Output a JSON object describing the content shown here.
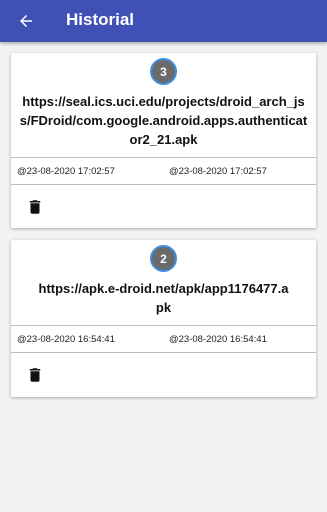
{
  "header": {
    "title": "Historial",
    "back_icon": "arrow-left-icon",
    "color": "#3f51b5"
  },
  "history": [
    {
      "badge": "3",
      "url": "https://seal.ics.uci.edu/projects/droid_arch_jss/FDroid/com.google.android.apps.authenticator2_21.apk",
      "date_start": "@23-08-2020 17:02:57",
      "date_end": "@23-08-2020 17:02:57",
      "delete_icon": "trash-icon"
    },
    {
      "badge": "2",
      "url": "https://apk.e-droid.net/apk/app1176477.apk",
      "date_start": "@23-08-2020 16:54:41",
      "date_end": "@23-08-2020 16:54:41",
      "delete_icon": "trash-icon"
    }
  ]
}
